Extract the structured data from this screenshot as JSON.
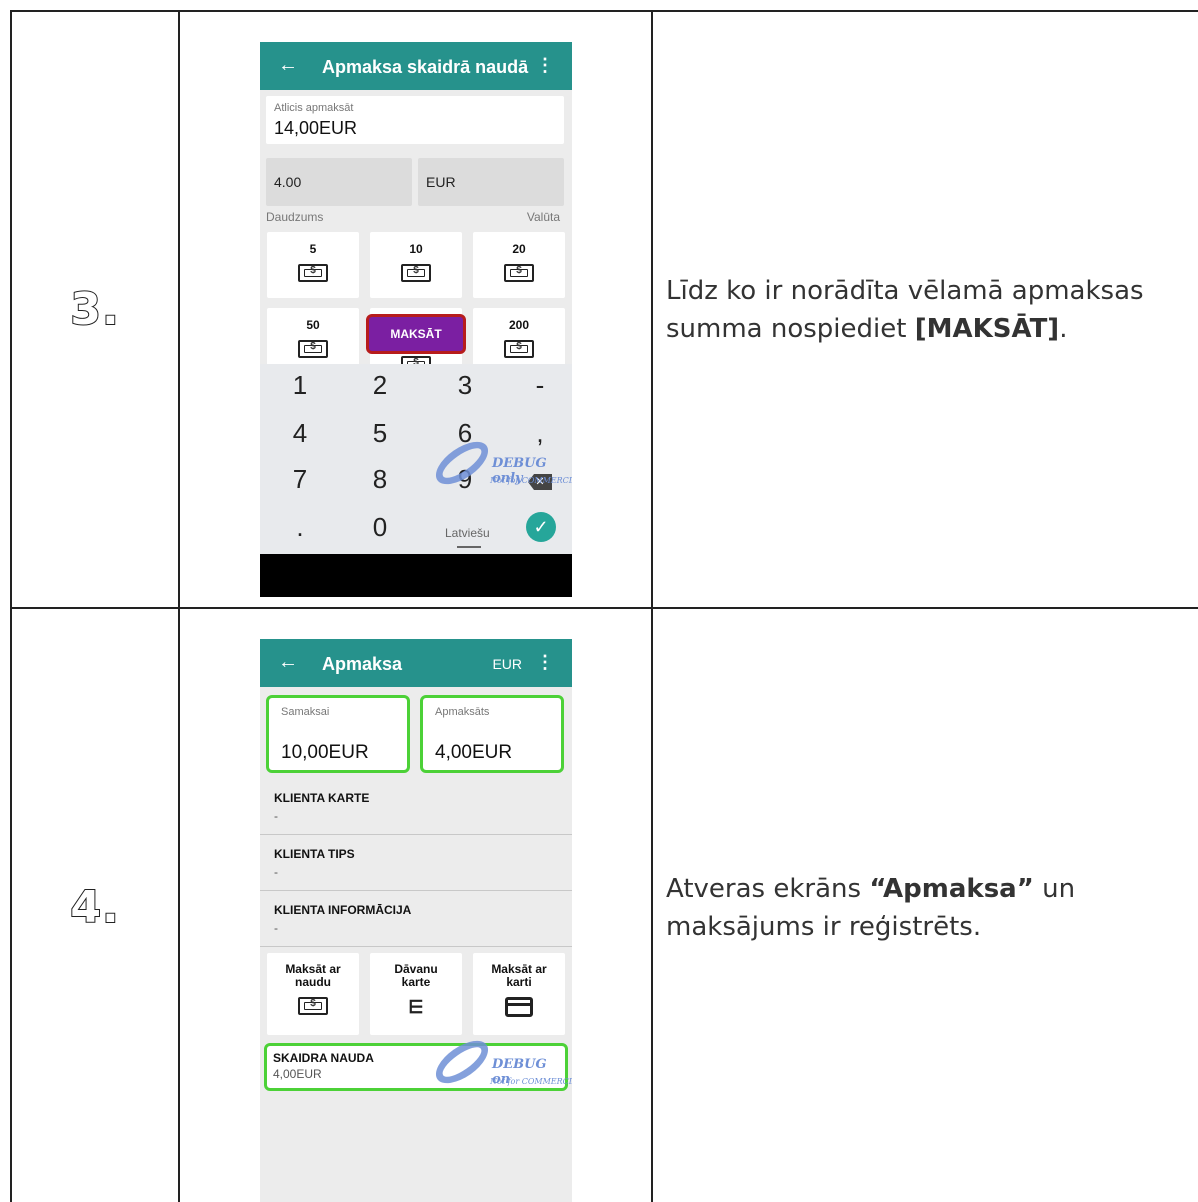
{
  "steps": [
    {
      "number": "3.",
      "description": {
        "line1": "Līdz ko ir norādīta vēlamā apmaksas",
        "line2_prefix": "summa nospiediet ",
        "line2_bold": "[MAKSĀT]",
        "line2_suffix": "."
      },
      "screen": {
        "title": "Apmaksa skaidrā naudā",
        "back_icon": "arrow-left-icon",
        "menu_icon": "more-vert-icon",
        "remaining_label": "Atlicis apmaksāt",
        "remaining_value": "14,00EUR",
        "amount_value": "4.00",
        "currency_value": "EUR",
        "amount_label": "Daudzums",
        "currency_label": "Valūta",
        "notes": [
          "5",
          "10",
          "20",
          "50",
          "200"
        ],
        "pay_button": "MAKSĀT",
        "keys": [
          "1",
          "2",
          "3",
          "-",
          "4",
          "5",
          "6",
          ",",
          "7",
          "8",
          "9",
          ".",
          "0"
        ],
        "keyboard_language": "Latviešu",
        "watermark": "DEBUG only",
        "watermark_sub": "Not for COMMERCIAL"
      }
    },
    {
      "number": "4.",
      "description": {
        "word1": "Atveras",
        "word2": "ekrāns",
        "bold": "“Apmaksa”",
        "word3": "un",
        "line2": "maksājums ir reģistrēts."
      },
      "screen": {
        "title": "Apmaksa",
        "currency": "EUR",
        "back_icon": "arrow-left-icon",
        "menu_icon": "more-vert-icon",
        "to_pay_label": "Samaksai",
        "to_pay_value": "10,00EUR",
        "paid_label": "Apmaksāts",
        "paid_value": "4,00EUR",
        "client_card_label": "KLIENTA KARTE",
        "client_card_value": "-",
        "client_type_label": "KLIENTA TIPS",
        "client_type_value": "-",
        "client_info_label": "KLIENTA INFORMĀCIJA",
        "client_info_value": "-",
        "pay_cash_line1": "Maksāt ar",
        "pay_cash_line2": "naudu",
        "gift_line1": "Dāvanu",
        "gift_line2": "karte",
        "pay_card_line1": "Maksāt ar",
        "pay_card_line2": "karti",
        "payment_method": "SKAIDRA NAUDA",
        "payment_amount": "4,00EUR",
        "watermark": "DEBUG on",
        "watermark_sub": "Not for COMMERCIAL"
      }
    }
  ]
}
